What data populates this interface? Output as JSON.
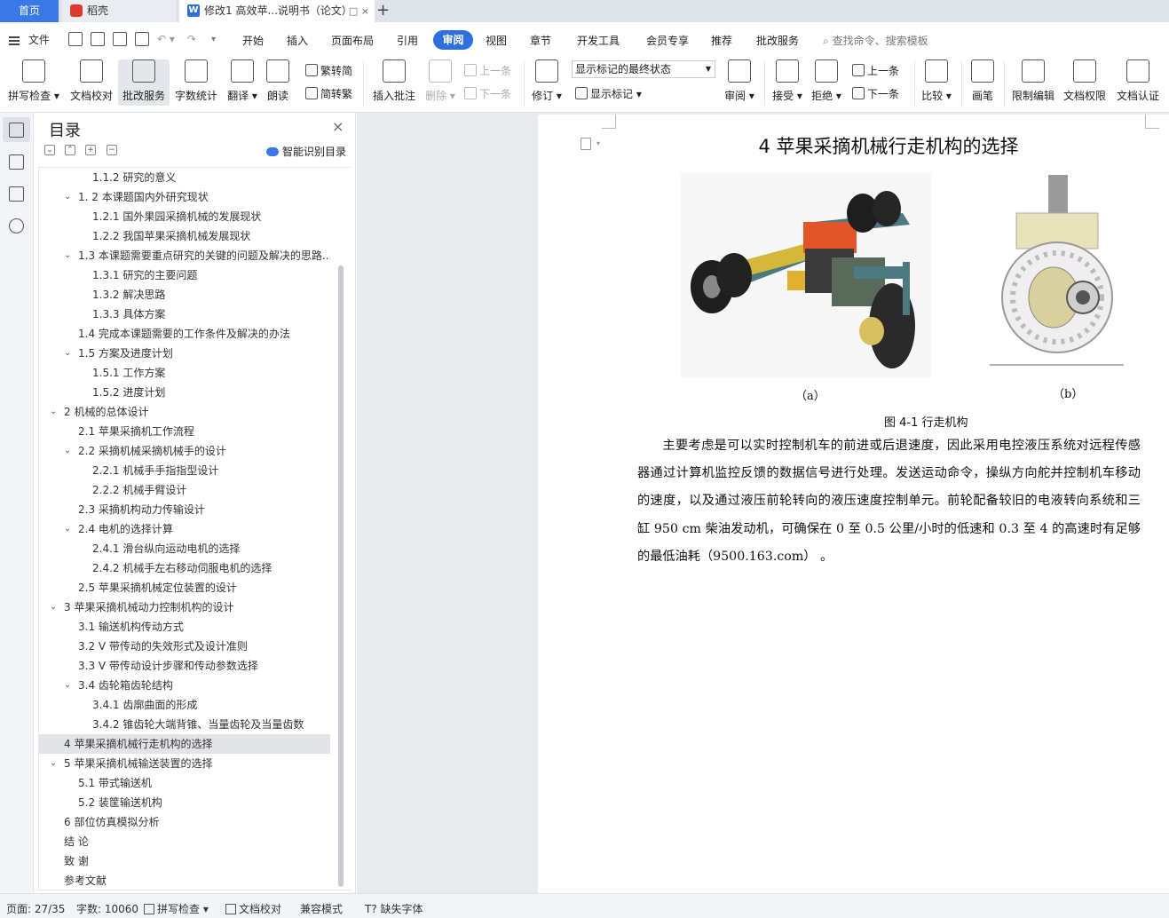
{
  "tabs": {
    "home": "首页",
    "daoke": "稻壳",
    "doc": "修改1 高效苹...说明书（论文）",
    "close": "□ ×",
    "add": "+"
  },
  "menu": {
    "file": "文件",
    "items": [
      "开始",
      "插入",
      "页面布局",
      "引用",
      "审阅",
      "视图",
      "章节",
      "开发工具",
      "会员专享",
      "推荐",
      "批改服务"
    ],
    "active": "审阅",
    "search": "查找命令、搜索模板"
  },
  "ribbon": {
    "spellcheck": "拼写检查",
    "proofread": "文档校对",
    "grading": "批改服务",
    "wordcount": "字数统计",
    "translate": "翻译",
    "readaloud": "朗读",
    "trad_to_simp": "繁转简",
    "simp_to_trad": "简转繁",
    "insert_comment": "插入批注",
    "delete": "删除",
    "prev": "上一条",
    "next": "下一条",
    "revise": "修订",
    "show_markup": "显示标记",
    "markup_state": "显示标记的最终状态",
    "review": "审阅",
    "accept": "接受",
    "reject": "拒绝",
    "prev2": "上一条",
    "next2": "下一条",
    "compare": "比较",
    "pen": "画笔",
    "restrict_edit": "限制编辑",
    "doc_permission": "文档权限",
    "doc_auth": "文档认证"
  },
  "toc": {
    "title": "目录",
    "smart": "智能识别目录",
    "items": [
      {
        "text": "1.1.2 研究的意义",
        "level": 3,
        "arrow": ""
      },
      {
        "text": "1. 2 本课题国内外研究现状",
        "level": 2,
        "arrow": "v"
      },
      {
        "text": "1.2.1 国外果园采摘机械的发展现状",
        "level": 3,
        "arrow": ""
      },
      {
        "text": "1.2.2 我国苹果采摘机械发展现状",
        "level": 3,
        "arrow": ""
      },
      {
        "text": "1.3 本课题需要重点研究的关键的问题及解决的思路...",
        "level": 2,
        "arrow": "v"
      },
      {
        "text": "1.3.1  研究的主要问题",
        "level": 3,
        "arrow": ""
      },
      {
        "text": "1.3.2  解决思路",
        "level": 3,
        "arrow": ""
      },
      {
        "text": "1.3.3 具体方案",
        "level": 3,
        "arrow": ""
      },
      {
        "text": "1.4 完成本课题需要的工作条件及解决的办法",
        "level": 2,
        "arrow": ""
      },
      {
        "text": "1.5  方案及进度计划",
        "level": 2,
        "arrow": "v"
      },
      {
        "text": "1.5.1  工作方案",
        "level": 3,
        "arrow": ""
      },
      {
        "text": "1.5.2 进度计划",
        "level": 3,
        "arrow": ""
      },
      {
        "text": "2 机械的总体设计",
        "level": 1,
        "arrow": "v"
      },
      {
        "text": "2.1 苹果采摘机工作流程",
        "level": 2,
        "arrow": ""
      },
      {
        "text": "2.2 采摘机械采摘机械手的设计",
        "level": 2,
        "arrow": "v"
      },
      {
        "text": "2.2.1 机械手手指指型设计",
        "level": 3,
        "arrow": ""
      },
      {
        "text": "2.2.2 机械手臂设计",
        "level": 3,
        "arrow": ""
      },
      {
        "text": "2.3 采摘机构动力传输设计",
        "level": 2,
        "arrow": ""
      },
      {
        "text": "2.4 电机的选择计算",
        "level": 2,
        "arrow": "v"
      },
      {
        "text": "2.4.1 滑台纵向运动电机的选择",
        "level": 3,
        "arrow": ""
      },
      {
        "text": "2.4.2 机械手左右移动伺服电机的选择",
        "level": 3,
        "arrow": ""
      },
      {
        "text": "2.5 苹果采摘机械定位装置的设计",
        "level": 2,
        "arrow": ""
      },
      {
        "text": "3 苹果采摘机械动力控制机构的设计",
        "level": 1,
        "arrow": "v"
      },
      {
        "text": "3.1 输送机构传动方式",
        "level": 2,
        "arrow": ""
      },
      {
        "text": "3.2 V 带传动的失效形式及设计准则",
        "level": 2,
        "arrow": ""
      },
      {
        "text": "3.3 V 带传动设计步骤和传动参数选择",
        "level": 2,
        "arrow": ""
      },
      {
        "text": "3.4 齿轮箱齿轮结构",
        "level": 2,
        "arrow": "v"
      },
      {
        "text": "3.4.1 齿廓曲面的形成",
        "level": 3,
        "arrow": ""
      },
      {
        "text": "3.4.2 锥齿轮大端背锥、当量齿轮及当量齿数",
        "level": 3,
        "arrow": ""
      },
      {
        "text": "4 苹果采摘机械行走机构的选择",
        "level": 1,
        "arrow": "",
        "selected": true
      },
      {
        "text": "5 苹果采摘机械输送装置的选择",
        "level": 1,
        "arrow": "v"
      },
      {
        "text": "5.1 带式输送机",
        "level": 2,
        "arrow": ""
      },
      {
        "text": "5.2  装筐输送机构",
        "level": 2,
        "arrow": ""
      },
      {
        "text": "6 部位仿真模拟分析",
        "level": 1,
        "arrow": ""
      },
      {
        "text": "结    论",
        "level": 1,
        "arrow": ""
      },
      {
        "text": "致    谢",
        "level": 1,
        "arrow": ""
      },
      {
        "text": "参考文献",
        "level": 1,
        "arrow": ""
      }
    ]
  },
  "document": {
    "heading": "4 苹果采摘机械行走机构的选择",
    "caption_a": "（a）",
    "caption_b": "（b）",
    "figure_title": "图 4-1  行走机构",
    "paragraph": "主要考虑是可以实时控制机车的前进或后退速度，因此采用电控液压系统对远程传感器通过计算机监控反馈的数据信号进行处理。发送运动命令，操纵方向舵并控制机车移动的速度，以及通过液压前轮转向的液压速度控制单元。前轮配备较旧的电液转向系统和三缸 950 cm  柴油发动机，可确保在 0  至 0.5  公里/小时的低速和 0.3  至 4  的高速时有足够的最低油耗（9500.163.com）  。"
  },
  "status": {
    "page": "页面: 27/35",
    "words": "字数: 10060",
    "spell": "拼写检查",
    "proof": "文档校对",
    "compat": "兼容模式",
    "missing_font": "缺失字体"
  }
}
